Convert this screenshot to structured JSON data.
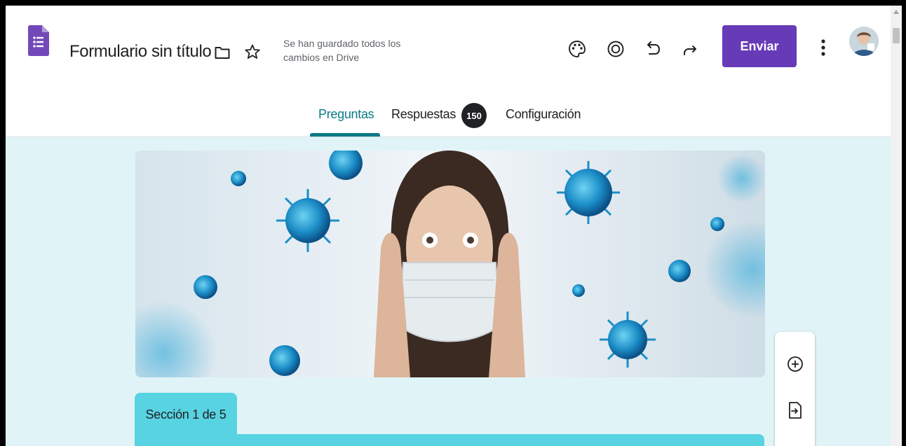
{
  "header": {
    "title": "Formulario sin título",
    "save_status": "Se han guardado todos los cambios en Drive",
    "send_label": "Enviar",
    "icons": [
      "forms-logo-icon",
      "folder-icon",
      "star-icon",
      "palette-icon",
      "preview-eye-icon",
      "undo-icon",
      "redo-icon",
      "more-vert-icon"
    ]
  },
  "tabs": [
    {
      "label": "Preguntas",
      "active": true
    },
    {
      "label": "Respuestas",
      "badge": "150"
    },
    {
      "label": "Configuración"
    }
  ],
  "section": {
    "label": "Sección 1 de 5"
  },
  "side_toolbar": {
    "icons": [
      "add-question-icon",
      "import-questions-icon"
    ]
  },
  "colors": {
    "brand": "#673ab7",
    "accent": "#0b7a86",
    "background": "#e0f4f7",
    "section": "#58d3e1"
  }
}
